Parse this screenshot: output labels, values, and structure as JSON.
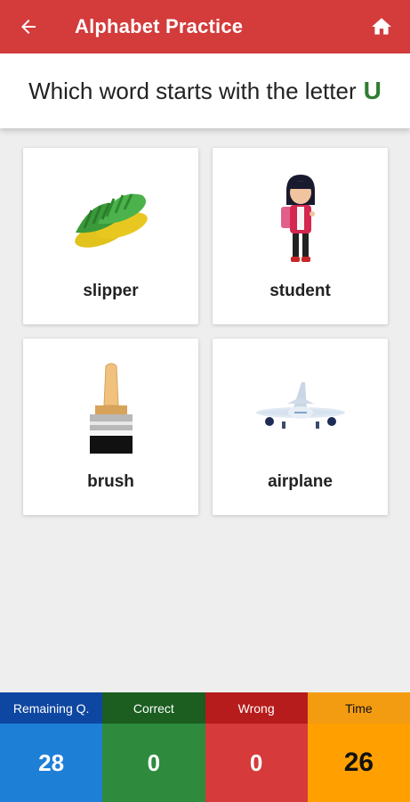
{
  "appbar": {
    "title": "Alphabet Practice",
    "back_icon": "arrow-left-icon",
    "home_icon": "home-icon",
    "color": "#d43b3b"
  },
  "question": {
    "text": "Which word starts with the letter",
    "letter": "U"
  },
  "options": [
    {
      "word": "slipper",
      "icon": "slipper-icon"
    },
    {
      "word": "student",
      "icon": "student-icon"
    },
    {
      "word": "brush",
      "icon": "brush-icon"
    },
    {
      "word": "airplane",
      "icon": "airplane-icon"
    }
  ],
  "stats": {
    "remaining": {
      "label": "Remaining Q.",
      "value": "28"
    },
    "correct": {
      "label": "Correct",
      "value": "0"
    },
    "wrong": {
      "label": "Wrong",
      "value": "0"
    },
    "time": {
      "label": "Time",
      "value": "26"
    }
  }
}
